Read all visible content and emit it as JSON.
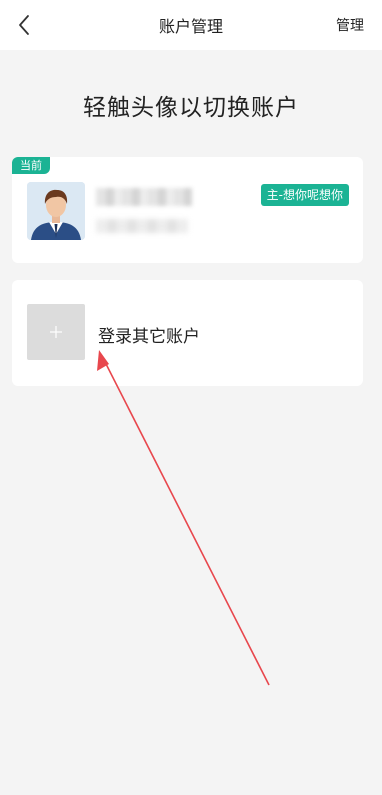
{
  "navbar": {
    "title": "账户管理",
    "manage_label": "管理",
    "back_icon": "chevron-left-icon"
  },
  "hint": "轻触头像以切换账户",
  "current_account": {
    "tag": "当前",
    "badge": "主-想你呢想你"
  },
  "add_account": {
    "label": "登录其它账户",
    "icon": "plus-icon"
  },
  "colors": {
    "accent": "#1bb394",
    "background": "#f4f4f4",
    "annotation_arrow": "#e8474d"
  }
}
